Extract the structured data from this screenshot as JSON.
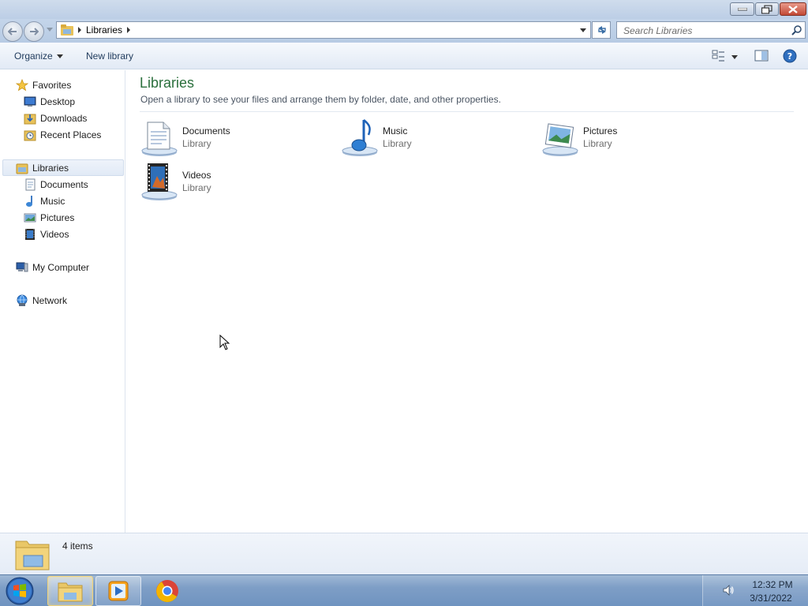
{
  "window": {
    "controls": {
      "minimize": "minimize",
      "maximize": "restore",
      "close": "close"
    }
  },
  "address": {
    "path": "Libraries",
    "search_placeholder": "Search Libraries"
  },
  "toolbar": {
    "organize_label": "Organize",
    "new_library_label": "New library"
  },
  "nav": {
    "favorites": {
      "label": "Favorites",
      "items": [
        {
          "label": "Desktop",
          "icon": "desktop-icon"
        },
        {
          "label": "Downloads",
          "icon": "downloads-icon"
        },
        {
          "label": "Recent Places",
          "icon": "recent-places-icon"
        }
      ]
    },
    "libraries": {
      "label": "Libraries",
      "selected": true,
      "items": [
        {
          "label": "Documents",
          "icon": "documents-icon"
        },
        {
          "label": "Music",
          "icon": "music-icon"
        },
        {
          "label": "Pictures",
          "icon": "pictures-icon"
        },
        {
          "label": "Videos",
          "icon": "videos-icon"
        }
      ]
    },
    "computer": {
      "label": "My Computer"
    },
    "network": {
      "label": "Network"
    }
  },
  "content": {
    "title": "Libraries",
    "subtitle": "Open a library to see your files and arrange them by folder, date, and other properties.",
    "libraries": [
      {
        "name": "Documents",
        "type": "Library",
        "icon": "documents-library-icon"
      },
      {
        "name": "Music",
        "type": "Library",
        "icon": "music-library-icon"
      },
      {
        "name": "Pictures",
        "type": "Library",
        "icon": "pictures-library-icon"
      },
      {
        "name": "Videos",
        "type": "Library",
        "icon": "videos-library-icon"
      }
    ]
  },
  "details": {
    "item_count": "4 items"
  },
  "taskbar": {
    "items": [
      "windows-explorer",
      "windows-media-player",
      "google-chrome"
    ],
    "clock_time": "12:32 PM",
    "clock_date": "3/31/2022"
  },
  "colors": {
    "title_green": "#2a6f3c",
    "taskbar_blue": "#7e9ec6",
    "close_red": "#c24935"
  }
}
